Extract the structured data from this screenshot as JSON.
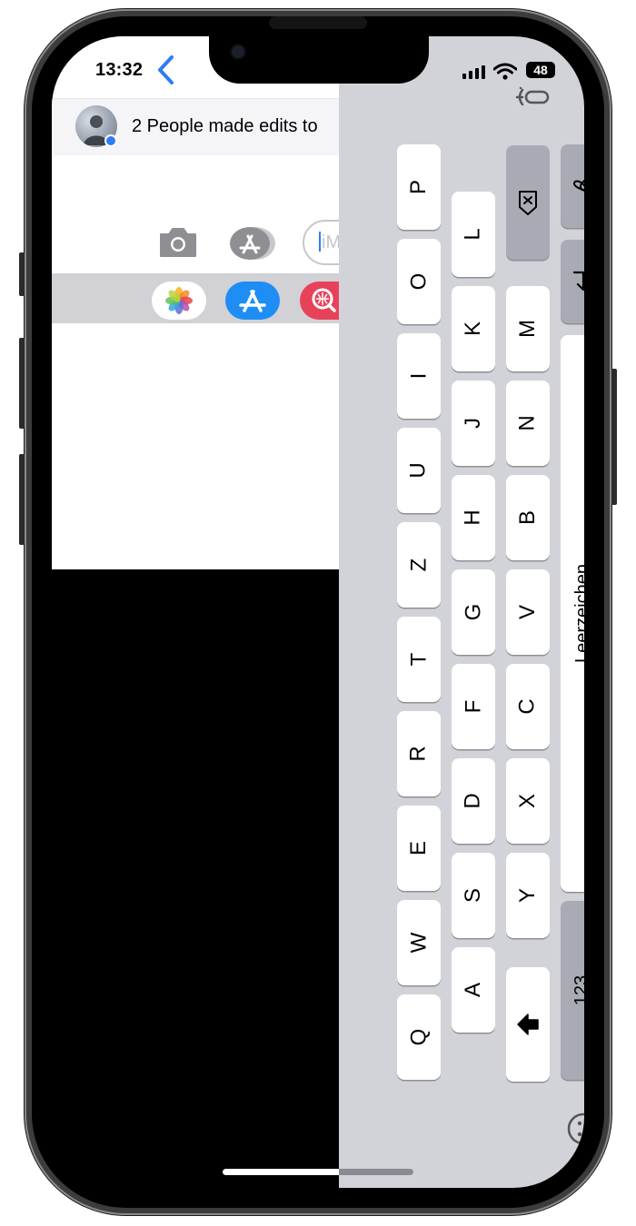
{
  "status_bar": {
    "time": "13:32",
    "battery": "48"
  },
  "conversation": {
    "header_text": "2 People made edits to",
    "input_placeholder": "iM"
  },
  "keyboard": {
    "keys": [
      "P",
      "O",
      "I",
      "U",
      "Z",
      "T",
      "R",
      "E",
      "W",
      "Q",
      "L",
      "K",
      "J",
      "H",
      "G",
      "F",
      "D",
      "S",
      "A",
      "M",
      "N",
      "B",
      "V",
      "C",
      "X",
      "Y"
    ],
    "space_label": "Leerzeichen",
    "numbers_label": "123"
  },
  "colors": {
    "accent": "#2f7cf6",
    "keyboard_bg": "#d1d3d9",
    "key_dark": "#a8abb3",
    "tray_bg": "#d1d1d6"
  },
  "icons": [
    "back-chevron-icon",
    "camera-icon",
    "app-store-icon",
    "photos-app-icon",
    "app-store-app-icon",
    "search-app-icon",
    "delete-icon",
    "handwriting-icon",
    "return-icon",
    "shift-icon",
    "emoji-icon",
    "dictation-mic-icon",
    "signal-icon",
    "wifi-icon",
    "battery-icon"
  ]
}
